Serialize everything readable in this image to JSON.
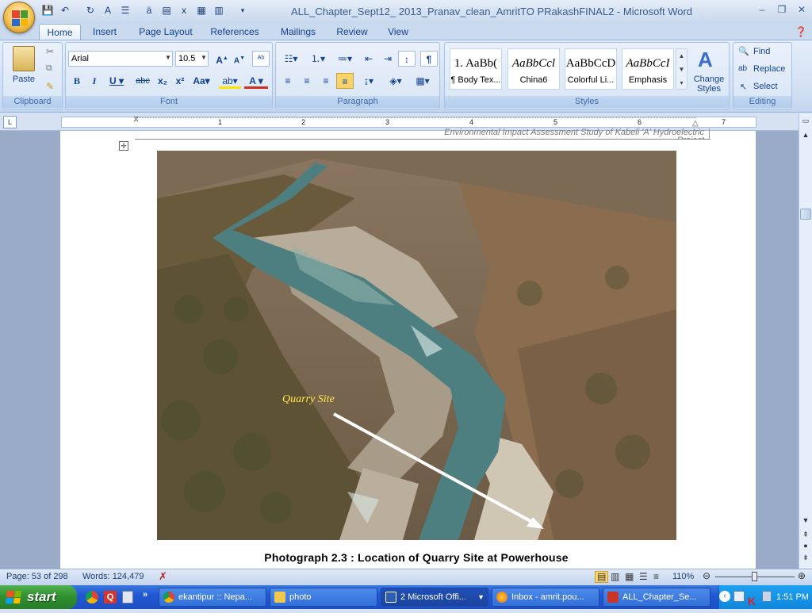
{
  "window": {
    "title": "ALL_Chapter_Sept12_ 2013_Pranav_clean_AmritTO PRakashFINAL2 - Microsoft Word"
  },
  "tabs": [
    "Home",
    "Insert",
    "Page Layout",
    "References",
    "Mailings",
    "Review",
    "View"
  ],
  "ribbon": {
    "clipboard": {
      "paste_label": "Paste",
      "group_label": "Clipboard"
    },
    "font": {
      "family": "Arial",
      "size": "10.5",
      "group_label": "Font"
    },
    "paragraph": {
      "group_label": "Paragraph"
    },
    "styles": {
      "group_label": "Styles",
      "items": [
        {
          "sample": "1. AaBb(",
          "name": "¶ Body Tex..."
        },
        {
          "sample": "AaBbCcl",
          "name": "China6"
        },
        {
          "sample": "AaBbCcD",
          "name": "Colorful Li..."
        },
        {
          "sample": "AaBbCcI",
          "name": "Emphasis"
        }
      ],
      "change_styles": "Change Styles"
    },
    "editing": {
      "find": "Find",
      "replace": "Replace",
      "select": "Select",
      "group_label": "Editing"
    }
  },
  "ruler": {
    "numbers": [
      "1",
      "2",
      "3",
      "4",
      "5",
      "6",
      "7"
    ]
  },
  "document": {
    "header_text": "Environmental Impact Assessment Study of Kabeli 'A' Hydroelectric Project",
    "photo_label": "Quarry Site",
    "caption": "Photograph 2.3 : Location of Quarry Site at Powerhouse"
  },
  "status": {
    "page": "Page: 53 of 298",
    "words": "Words: 124,479",
    "zoom": "110%"
  },
  "taskbar": {
    "start": "start",
    "tasks": [
      {
        "label": "ekantipur :: Nepa...",
        "color": "#e8442f"
      },
      {
        "label": "photo",
        "color": "#f1c84b"
      },
      {
        "label": "2 Microsoft Offi...",
        "color": "#2c5db8"
      },
      {
        "label": "Inbox - amrit.pou...",
        "color": "#e06c1e"
      },
      {
        "label": "ALL_Chapter_Se...",
        "color": "#c8342a"
      }
    ],
    "clock": "1:51 PM"
  },
  "colors": {
    "ribbon_bg": "#d2e0f3",
    "taskbar": "#2258d4",
    "start": "#2f8f2f",
    "label_yellow": "#ffe94a"
  }
}
